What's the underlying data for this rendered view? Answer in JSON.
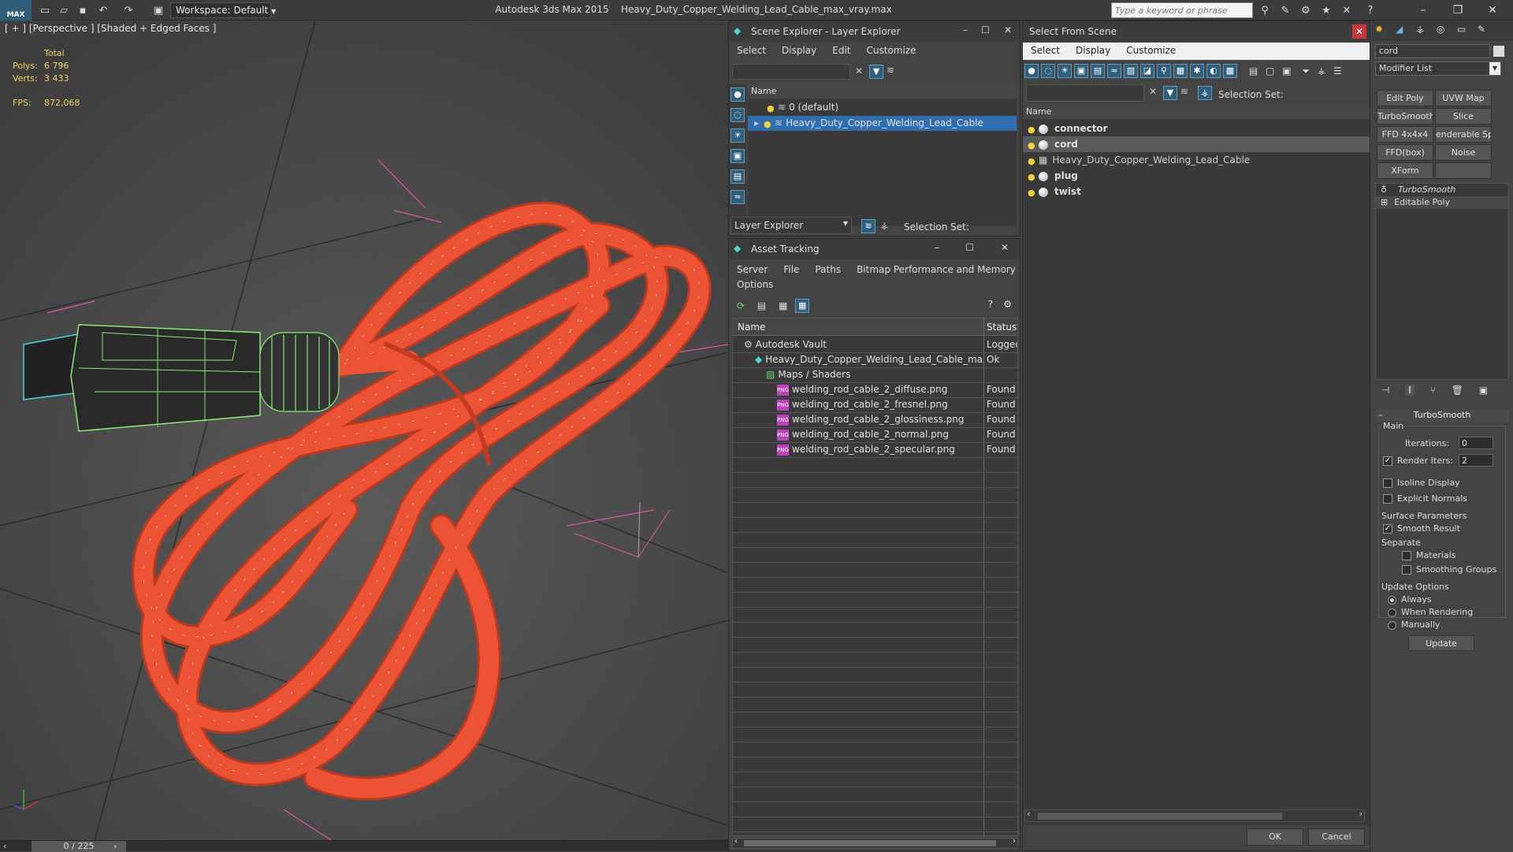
{
  "app": {
    "logo_text": "MAX",
    "workspace_label": "Workspace: Default",
    "app_name": "Autodesk 3ds Max  2015",
    "file_name": "Heavy_Duty_Copper_Welding_Lead_Cable_max_vray.max",
    "search_placeholder": "Type a keyword or phrase"
  },
  "viewport": {
    "label": "[ + ] [Perspective ] [Shaded + Edged Faces ]",
    "stats": {
      "total_label": "Total",
      "polys_label": "Polys:",
      "polys": "6 796",
      "verts_label": "Verts:",
      "verts": "3 433",
      "fps_label": "FPS:",
      "fps": "872,068"
    },
    "frame": "0 / 225",
    "colors": {
      "cable": "#e8472a",
      "plug": "#8ee87a",
      "grid": "#d95aa3"
    }
  },
  "scene_explorer": {
    "title": "Scene Explorer - Layer Explorer",
    "menu": [
      "Select",
      "Display",
      "Edit",
      "Customize"
    ],
    "col_name": "Name",
    "rows": [
      "0 (default)",
      "Heavy_Duty_Copper_Welding_Lead_Cable"
    ],
    "footer_combo": "Layer Explorer",
    "selection_set": "Selection Set:"
  },
  "asset_tracking": {
    "title": "Asset Tracking",
    "menu": [
      "Server",
      "File",
      "Paths",
      "Bitmap Performance and Memory"
    ],
    "menu2": "Options",
    "col_name": "Name",
    "col_status": "Status",
    "rows": [
      {
        "name": "Autodesk Vault",
        "status": "Logged",
        "indent": 0
      },
      {
        "name": "Heavy_Duty_Copper_Welding_Lead_Cable_max...",
        "status": "Ok",
        "indent": 1
      },
      {
        "name": "Maps / Shaders",
        "status": "",
        "indent": 2
      },
      {
        "name": "welding_rod_cable_2_diffuse.png",
        "status": "Found",
        "indent": 3
      },
      {
        "name": "welding_rod_cable_2_fresnel.png",
        "status": "Found",
        "indent": 3
      },
      {
        "name": "welding_rod_cable_2_glossiness.png",
        "status": "Found",
        "indent": 3
      },
      {
        "name": "welding_rod_cable_2_normal.png",
        "status": "Found",
        "indent": 3
      },
      {
        "name": "welding_rod_cable_2_specular.png",
        "status": "Found",
        "indent": 3
      }
    ]
  },
  "select_from_scene": {
    "title": "Select From Scene",
    "menu": [
      "Select",
      "Display",
      "Customize"
    ],
    "selection_set": "Selection Set:",
    "col_name": "Name",
    "rows": [
      "connector",
      "cord",
      "Heavy_Duty_Copper_Welding_Lead_Cable",
      "plug",
      "twist"
    ],
    "ok": "OK",
    "cancel": "Cancel"
  },
  "command_panel": {
    "object_name": "cord",
    "modifier_list": "Modifier List",
    "buttons": [
      "Edit Poly",
      "UVW Map",
      "TurboSmooth",
      "Slice",
      "FFD 4x4x4",
      "enderable Splin",
      "FFD(box)",
      "Noise",
      "XForm",
      ""
    ],
    "stack": [
      "TurboSmooth",
      "Editable Poly"
    ],
    "rollout_title": "TurboSmooth",
    "main_label": "Main",
    "iterations_label": "Iterations:",
    "iterations": "0",
    "render_iters_label": "Render Iters:",
    "render_iters": "2",
    "isoline": "Isoline Display",
    "explicit": "Explicit Normals",
    "surface_params": "Surface Parameters",
    "smooth_result": "Smooth Result",
    "separate": "Separate",
    "materials": "Materials",
    "smoothing_groups": "Smoothing Groups",
    "update_options": "Update Options",
    "always": "Always",
    "when_rendering": "When Rendering",
    "manually": "Manually",
    "update_btn": "Update"
  }
}
